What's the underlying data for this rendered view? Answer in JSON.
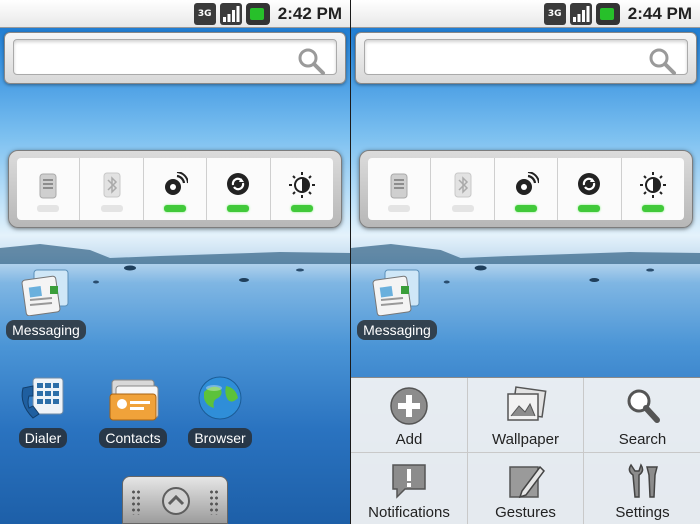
{
  "screens": [
    {
      "status": {
        "network": "3G",
        "time": "2:42 PM"
      },
      "search": {
        "placeholder": ""
      },
      "apps": {
        "messaging": "Messaging",
        "dialer": "Dialer",
        "contacts": "Contacts",
        "browser": "Browser"
      }
    },
    {
      "status": {
        "network": "3G",
        "time": "2:44 PM"
      },
      "search": {
        "placeholder": ""
      },
      "apps": {
        "messaging": "Messaging"
      },
      "menu": {
        "items": [
          {
            "label": "Add",
            "icon": "add-icon"
          },
          {
            "label": "Wallpaper",
            "icon": "wallpaper-icon"
          },
          {
            "label": "Search",
            "icon": "search-icon"
          },
          {
            "label": "Notifications",
            "icon": "notifications-icon"
          },
          {
            "label": "Gestures",
            "icon": "gestures-icon"
          },
          {
            "label": "Settings",
            "icon": "settings-icon"
          }
        ]
      }
    }
  ],
  "power_widget": {
    "toggles": [
      {
        "name": "wifi",
        "on": false
      },
      {
        "name": "bluetooth",
        "on": false
      },
      {
        "name": "gps",
        "on": true
      },
      {
        "name": "sync",
        "on": true
      },
      {
        "name": "brightness",
        "on": true
      }
    ]
  },
  "colors": {
    "indicator_on": "#41c93a",
    "label_bg": "#282828",
    "battery": "#27c02a"
  }
}
